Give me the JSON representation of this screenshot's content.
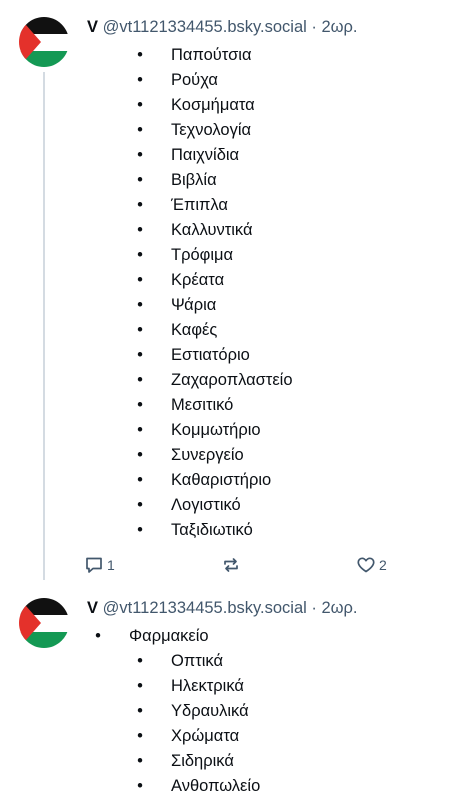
{
  "post1": {
    "author_name": "V",
    "handle": "@vt1121334455.bsky.social",
    "separator": "·",
    "time": "2ωρ.",
    "items": [
      "Παπούτσια",
      "Ρούχα",
      "Κοσμήματα",
      "Τεχνολογία",
      "Παιχνίδια",
      "Βιβλία",
      "Έπιπλα",
      "Καλλυντικά",
      "Τρόφιμα",
      "Κρέατα",
      "Ψάρια",
      "Καφές",
      "Εστιατόριο",
      "Ζαχαροπλαστείο",
      "Μεσιτικό",
      "Κομμωτήριο",
      "Συνεργείο",
      "Καθαριστήριο",
      "Λογιστικό",
      "Ταξιδιωτικό"
    ],
    "actions": {
      "reply_icon": "reply-icon",
      "reply_count": "1",
      "repost_icon": "repost-icon",
      "like_icon": "heart-icon",
      "like_count": "2"
    }
  },
  "post2": {
    "author_name": "V",
    "handle": "@vt1121334455.bsky.social",
    "separator": "·",
    "time": "2ωρ.",
    "top_item": "Φαρμακείο",
    "items": [
      "Οπτικά",
      "Ηλεκτρικά",
      "Υδραυλικά",
      "Χρώματα",
      "Σιδηρικά",
      "Ανθοπωλείο"
    ]
  },
  "colors": {
    "text": "#0b0f14",
    "muted": "#42576c",
    "thread_line": "#d4dbe2",
    "flag_black": "#111111",
    "flag_white": "#ffffff",
    "flag_green": "#149954",
    "flag_red": "#e4312b"
  },
  "bullet": "•"
}
